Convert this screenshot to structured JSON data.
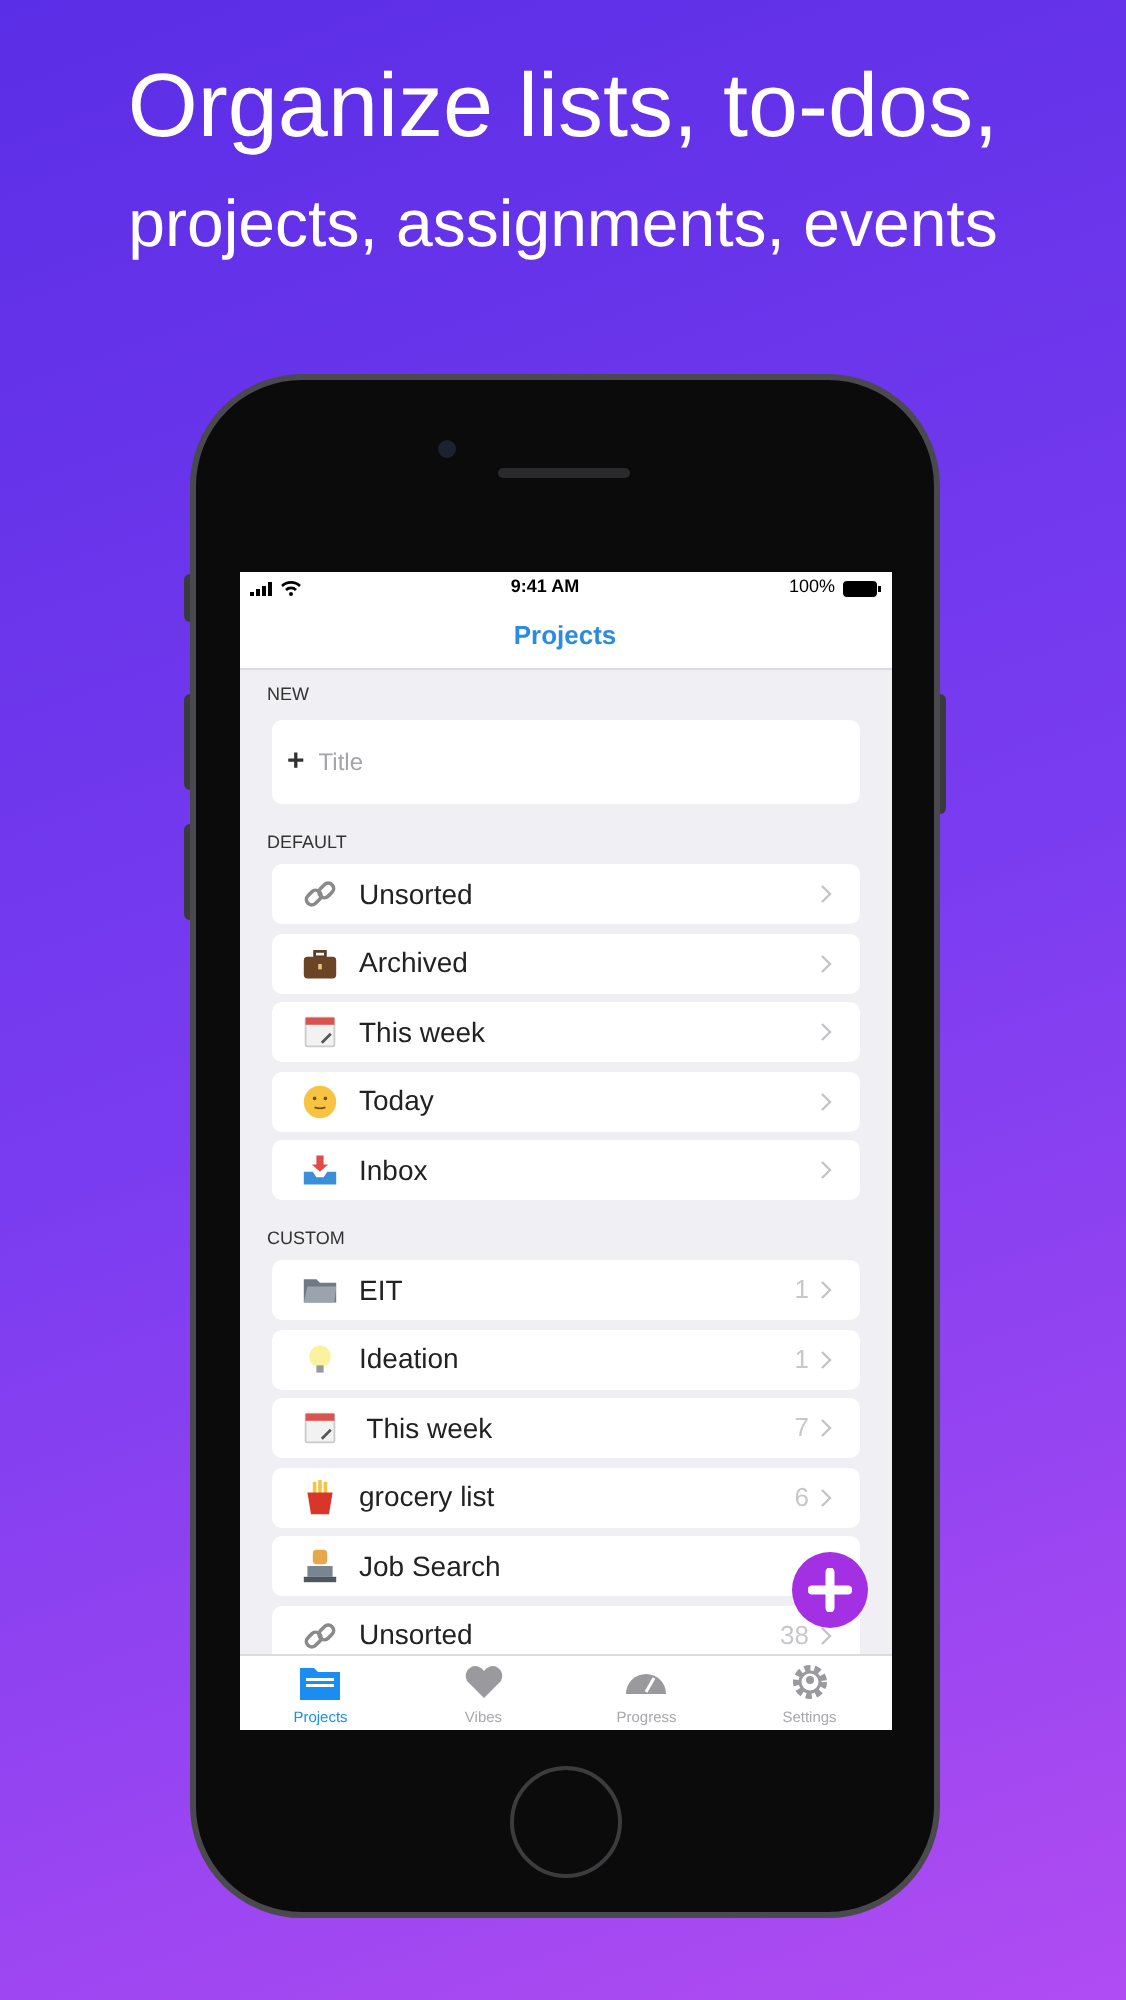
{
  "headline": [
    "Organize lists, to-dos,",
    "projects, assignments, events"
  ],
  "status_bar": {
    "time": "9:41 AM",
    "battery": "100%"
  },
  "nav_title": "Projects",
  "new_section": {
    "header": "NEW",
    "field": {
      "icon": "+",
      "placeholder": "Title"
    }
  },
  "groups": [
    {
      "header": "DEFAULT",
      "items": [
        {
          "label": "Unsorted",
          "kind": "link"
        },
        {
          "label": "Archived",
          "kind": "briefcase"
        },
        {
          "label": "This week",
          "kind": "calendar"
        },
        {
          "label": "Today",
          "kind": "smiley"
        },
        {
          "label": "Inbox",
          "kind": "inbox"
        }
      ]
    },
    {
      "header": "CUSTOM",
      "items": [
        {
          "label": "EIT",
          "kind": "folder",
          "count": "1"
        },
        {
          "label": "Ideation",
          "kind": "bulb",
          "count": "1"
        },
        {
          "label": " This week",
          "kind": "calendar",
          "count": "7"
        },
        {
          "label": "grocery list",
          "kind": "fries",
          "count": "6"
        },
        {
          "label": "Job Search",
          "kind": "laptop"
        },
        {
          "label": "Unsorted",
          "kind": "link",
          "count": "38"
        }
      ]
    }
  ],
  "tabs": [
    {
      "label": "Projects",
      "kind": "folder",
      "selected": true
    },
    {
      "label": "Vibes",
      "kind": "heart",
      "selected": false
    },
    {
      "label": "Progress",
      "kind": "gauge",
      "selected": false
    },
    {
      "label": "Settings",
      "kind": "gear",
      "selected": false
    }
  ]
}
